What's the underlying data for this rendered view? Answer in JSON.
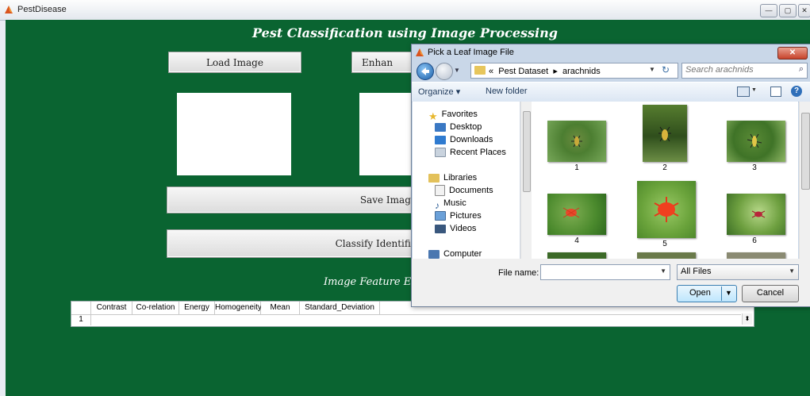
{
  "main_window": {
    "title": "PestDisease",
    "controls": [
      "—",
      "▢",
      "✕"
    ]
  },
  "app": {
    "heading": "Pest Classification using Image Processing",
    "load_button": "Load Image",
    "enhance_button": "Enhan",
    "save_button": "Save Image",
    "classify_button": "Classify Identifie",
    "feature_heading": "Image Feature Ex",
    "table": {
      "columns": [
        "Contrast",
        "Co-relation",
        "Energy",
        "Homogeneity",
        "Mean",
        "Standard_Deviation"
      ],
      "rows": [
        "1"
      ]
    }
  },
  "dialog": {
    "title": "Pick a Leaf Image File",
    "close": "✕",
    "breadcrumb": {
      "prefix": "«",
      "parts": [
        "Pest Dataset",
        "arachnids"
      ],
      "separator": "▸"
    },
    "search_placeholder": "Search arachnids",
    "toolbar": {
      "organize": "Organize ▾",
      "new_folder": "New folder"
    },
    "nav": {
      "favorites": "Favorites",
      "desktop": "Desktop",
      "downloads": "Downloads",
      "recent": "Recent Places",
      "libraries": "Libraries",
      "documents": "Documents",
      "music": "Music",
      "pictures": "Pictures",
      "videos": "Videos",
      "computer": "Computer"
    },
    "files": [
      "1",
      "2",
      "3",
      "4",
      "5",
      "6"
    ],
    "filename_label": "File name:",
    "filename_value": "",
    "filetype": "All Files",
    "open_button": "Open",
    "cancel_button": "Cancel"
  },
  "colors": {
    "app_background": "#0a6431",
    "dialog_frame": "#c9d7e8"
  }
}
